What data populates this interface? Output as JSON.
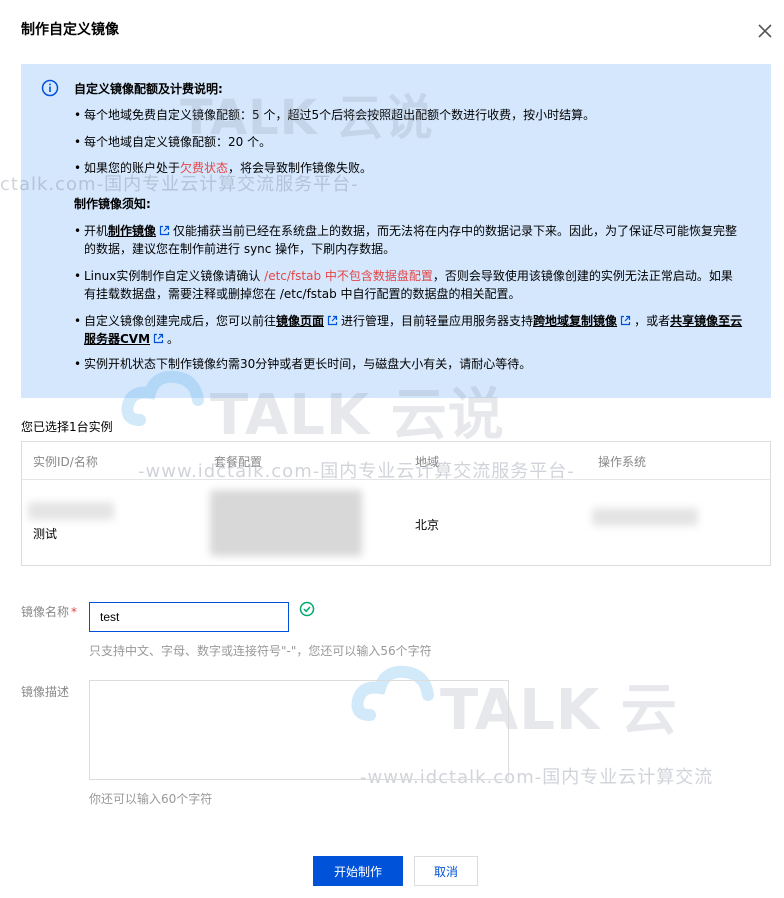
{
  "dialog": {
    "title": "制作自定义镜像",
    "close_icon": "close-icon"
  },
  "notice": {
    "icon": "info-circle-icon",
    "section1_heading": "自定义镜像配额及计费说明:",
    "section1_items": [
      {
        "pre": "每个地域免费自定义镜像配额：5 个，超过5个后将会按照超出配额个数进行收费，按小时结算。"
      },
      {
        "pre": "每个地域自定义镜像配额：20 个。"
      },
      {
        "pre": "如果您的账户处于",
        "red": "欠费状态",
        "post": "，将会导致制作镜像失败。"
      }
    ],
    "section2_heading": "制作镜像须知:",
    "item_a": {
      "pre": "开机",
      "link": "制作镜像",
      "post": "仅能捕获当前已经在系统盘上的数据，而无法将在内存中的数据记录下来。因此，为了保证尽可能恢复完整的数据，建议您在制作前进行 sync 操作，下刷内存数据。"
    },
    "item_b": {
      "pre": "Linux实例制作自定义镜像请确认 ",
      "red": "/etc/fstab 中不包含数据盘配置",
      "post": "，否则会导致使用该镜像创建的实例无法正常启动。如果有挂载数据盘，需要注释或删掉您在 /etc/fstab 中自行配置的数据盘的相关配置。"
    },
    "item_c": {
      "pre": "自定义镜像创建完成后，您可以前往",
      "link1": "镜像页面",
      "mid1": "进行管理，目前轻量应用服务器支持",
      "link2": "跨地域复制镜像",
      "mid2": "，或者",
      "link3": "共享镜像至云服务器CVM",
      "post": "。"
    },
    "item_d": {
      "pre": "实例开机状态下制作镜像约需30分钟或者更长时间，与磁盘大小有关，请耐心等待。"
    },
    "bullet": "•"
  },
  "watermarks": {
    "brand": "TALK 云说",
    "url": "-www.idctalk.com-国内专业云计算交流服务平台-",
    "url_partial": "ctalk.com-国内专业云计算交流服务平台-",
    "url_cut": "-www.idctalk.com-国内专业云计算交流",
    "brand_cut": "TALK 云"
  },
  "instances": {
    "selected_label": "您已选择1台实例",
    "columns": [
      "实例ID/名称",
      "套餐配置",
      "地域",
      "操作系统"
    ],
    "rows": [
      {
        "name": "测试",
        "region": "北京"
      }
    ]
  },
  "form": {
    "name_label": "镜像名称",
    "required_mark": "*",
    "name_value": "test",
    "name_hint": "只支持中文、字母、数字或连接符号\"-\"，您还可以输入56个字符",
    "desc_label": "镜像描述",
    "desc_value": "",
    "desc_hint": "你还可以输入60个字符",
    "valid_icon": "check-circle-icon"
  },
  "footer": {
    "submit_label": "开始制作",
    "cancel_label": "取消"
  },
  "colors": {
    "primary": "#0052d9",
    "notice_bg": "#d5e7fd",
    "warning_red": "#e54545",
    "success_green": "#00a870"
  }
}
